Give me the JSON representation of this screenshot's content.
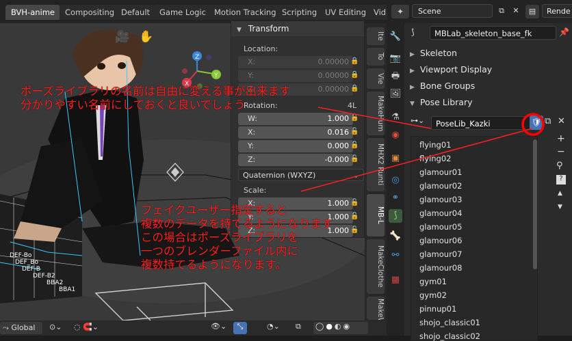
{
  "topbar": {
    "tabs": [
      "BVH-anime",
      "Compositing",
      "Default",
      "Game Logic",
      "Motion Tracking",
      "Scripting",
      "UV Editing",
      "Vid"
    ],
    "scene": "Scene",
    "render": "Rende"
  },
  "transform": {
    "title": "Transform",
    "location_label": "Location:",
    "location": [
      {
        "axis": "X:",
        "value": "0.00000"
      },
      {
        "axis": "Y:",
        "value": "0.00000"
      },
      {
        "axis": "Z:",
        "value": "0.00000"
      }
    ],
    "rotation_label": "Rotation:",
    "rotation_mode_short": "4L",
    "rotation": [
      {
        "axis": "W:",
        "value": "1.000"
      },
      {
        "axis": "X:",
        "value": "0.016"
      },
      {
        "axis": "Y:",
        "value": "0.000"
      },
      {
        "axis": "Z:",
        "value": "-0.000"
      }
    ],
    "rotation_mode": "Quaternion (WXYZ)",
    "scale_label": "Scale:",
    "scale": [
      {
        "axis": "X:",
        "value": "1.000"
      },
      {
        "axis": "Y:",
        "value": "1.000"
      },
      {
        "axis": "Z:",
        "value": "1.000"
      }
    ]
  },
  "sidetabs": [
    "Ite",
    "To",
    "Vie",
    "MakeHum",
    "MHX2 Runti",
    "MB-L",
    "MakeClothe",
    "MakeWa"
  ],
  "viewport": {
    "orientation": "Global",
    "bones": [
      "DEF-Bo",
      "DEF_Bo",
      "DEF-B",
      "DEF-B2",
      "BBA2",
      "BBA1"
    ]
  },
  "properties": {
    "object_name": "MBLab_skeleton_base_fk",
    "sections": [
      "Skeleton",
      "Viewport Display",
      "Bone Groups",
      "Pose Library"
    ],
    "poselib_name": "PoseLib_Kazki",
    "poses": [
      "flying01",
      "flying02",
      "glamour01",
      "glamour02",
      "glamour03",
      "glamour04",
      "glamour05",
      "glamour06",
      "glamour07",
      "glamour08",
      "gym01",
      "gym02",
      "pinnup01",
      "shojo_classic01",
      "shojo_classic02"
    ]
  },
  "annotations": {
    "top": [
      "ポーズライブラリの名前は自由に変える事が出来ます",
      "分かりやすい名前にしておくと良いでしょう"
    ],
    "bottom": [
      "フェイクユーザー指定すると",
      "複数のデータを持てるようになります",
      "この場合はポーズライブラリを",
      "一つのブレンダーファイル内に",
      "複数持てるようになります。"
    ]
  },
  "colors": {
    "accent": "#4772b3",
    "annotation": "#ff1f1f",
    "highlight_circle": "#ff0000"
  }
}
